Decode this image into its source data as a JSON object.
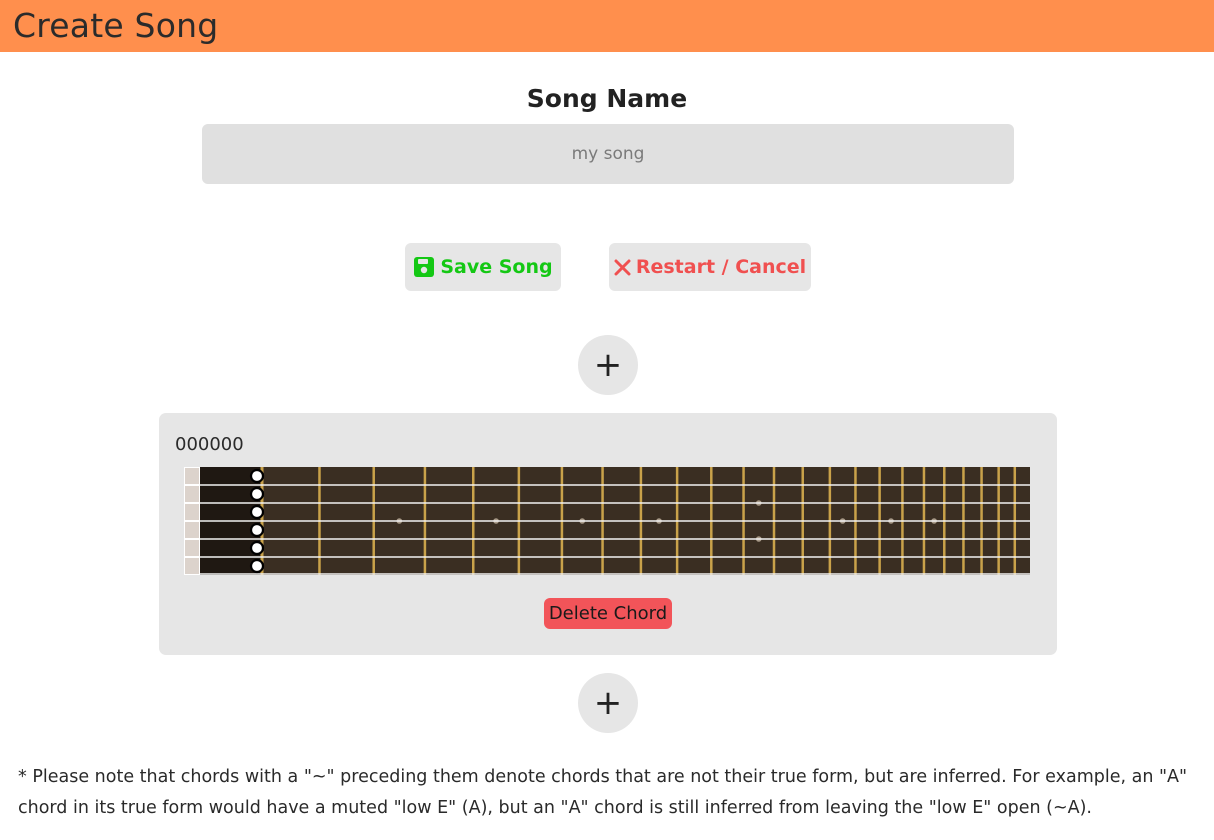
{
  "header": {
    "title": "Create Song"
  },
  "song_name": {
    "label": "Song Name",
    "placeholder": "my song",
    "value": ""
  },
  "actions": {
    "save_label": "Save Song",
    "save_icon": "floppy-disk-icon",
    "cancel_label": "Restart / Cancel",
    "cancel_icon": "close-x-icon",
    "save_color": "#14c814",
    "cancel_color": "#f05050"
  },
  "add_chord": {
    "label": "+"
  },
  "chord": {
    "name": "000000",
    "strings": 6,
    "frets": 24,
    "open_strings": [
      true,
      true,
      true,
      true,
      true,
      true
    ],
    "inlay_frets": [
      3,
      5,
      7,
      9,
      12,
      15,
      17,
      19
    ],
    "double_inlay_frets": [
      12
    ],
    "delete_label": "Delete Chord"
  },
  "colors": {
    "header": "#ff8f4d",
    "fretboard": "#3a2e22",
    "nut_area": "#1f1812",
    "fret_wire": "#c9a24a",
    "string": "#f2f2f2",
    "delete": "#f25459"
  },
  "footnote": "* Please note that chords with a \"~\" preceding them denote chords that are not their true form, but are inferred. For example, an \"A\" chord in its true form would have a muted \"low E\" (A), but an \"A\" chord is still inferred from leaving the \"low E\" open (~A)."
}
